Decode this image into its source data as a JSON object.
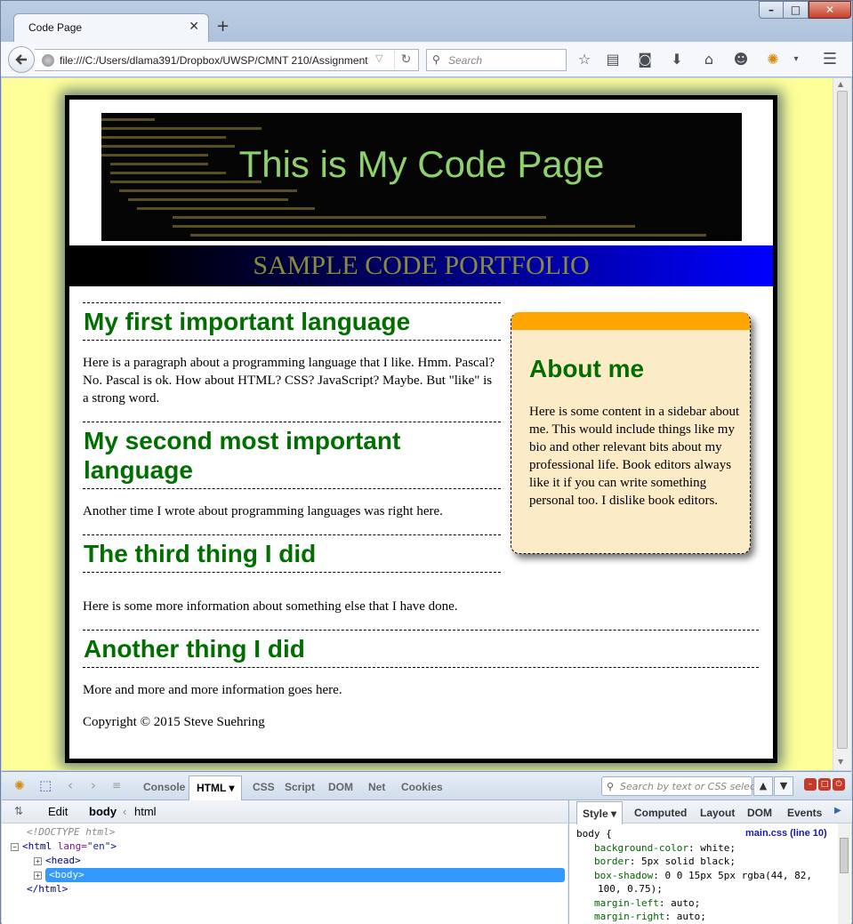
{
  "browser": {
    "tab_title": "Code Page",
    "tab_close": "✕",
    "new_tab": "+",
    "url": "file:///C:/Users/dlama391/Dropbox/UWSP/CMNT 210/Assignment",
    "search_placeholder": "Search",
    "window_controls": {
      "minimize": "–",
      "maximize": "□",
      "close": "✕"
    }
  },
  "page": {
    "banner_title": "This is My Code Page",
    "subtitle": "SAMPLE CODE PORTFOLIO",
    "sections": [
      {
        "heading": "My first important language",
        "body": "Here is a paragraph about a programming language that I like. Hmm. Pascal? No. Pascal is ok. How about HTML? CSS? JavaScript? Maybe. But \"like\" is a strong word."
      },
      {
        "heading": "My second most important language",
        "body": "Another time I wrote about programming languages was right here."
      },
      {
        "heading": "The third thing I did",
        "body": "Here is some more information about something else that I have done."
      },
      {
        "heading": "Another thing I did",
        "body": "More and more and more information goes here."
      }
    ],
    "copyright": "Copyright © 2015 Steve Suehring",
    "sidebar": {
      "heading": "About me",
      "body": "Here is some content in a sidebar about me. This would include things like my bio and other relevant bits about my professional life. Book editors always like it if you can write something personal too. I dislike book editors."
    },
    "colors": {
      "page_bg": "#ffff99",
      "heading": "#006f00",
      "sidebar_bg": "#fbebc6",
      "sidebar_top": "#ffa500",
      "banner_text": "#8fd16a"
    }
  },
  "devtools": {
    "tabs": [
      "Console",
      "HTML",
      "CSS",
      "Script",
      "DOM",
      "Net",
      "Cookies"
    ],
    "active_tab": "HTML",
    "search_placeholder": "Search by text or CSS selecto",
    "edit_label": "Edit",
    "breadcrumb_body": "body",
    "breadcrumb_sep": "‹",
    "breadcrumb_html": "html",
    "tree": {
      "doctype": "<!DOCTYPE html>",
      "html_open_tag": "<html",
      "html_attr_name": "lang=",
      "html_attr_value": "\"en\"",
      "html_open_end": ">",
      "head": "<head>",
      "body": "<body>",
      "html_close": "</html>"
    },
    "side_tabs": [
      "Style",
      "Computed",
      "Layout",
      "DOM",
      "Events"
    ],
    "active_side_tab": "Style",
    "css_selector": "body {",
    "css_source": "main.css (line 10)",
    "css_rules": [
      {
        "prop": "background-color",
        "value": "white;"
      },
      {
        "prop": "border",
        "value": "5px solid black;"
      },
      {
        "prop": "box-shadow",
        "value": "0 0 15px 5px rgba(44, 82,"
      },
      {
        "prop": "",
        "value": "100, 0.75);"
      },
      {
        "prop": "margin-left",
        "value": "auto;"
      },
      {
        "prop": "margin-right",
        "value": "auto;"
      }
    ]
  }
}
